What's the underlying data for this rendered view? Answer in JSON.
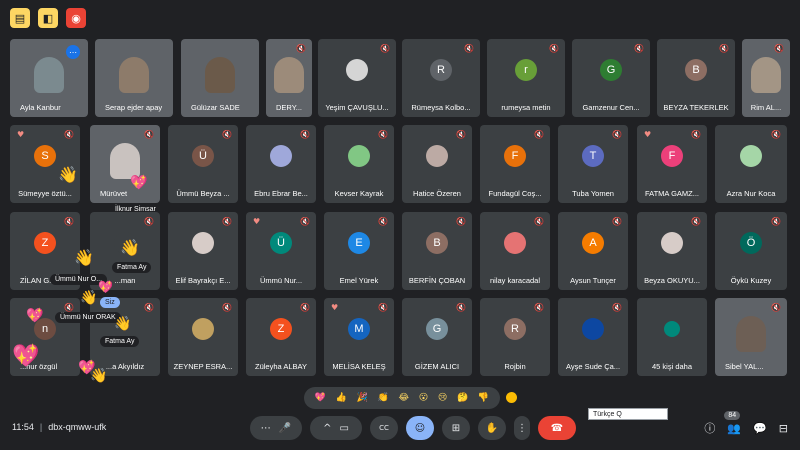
{
  "top_icons": [
    {
      "icon": "file-icon",
      "glyph": "▤",
      "style": "yellow"
    },
    {
      "icon": "present-icon",
      "glyph": "◧",
      "style": "yellow"
    },
    {
      "icon": "record-icon",
      "glyph": "◉",
      "style": "red"
    }
  ],
  "rows": [
    [
      {
        "name": "Ayla Kanbur",
        "video": true,
        "color": "#7b8a8f",
        "more": true,
        "left": true
      },
      {
        "name": "Serap ejder apay",
        "video": true,
        "color": "#8d7b6a",
        "left": true
      },
      {
        "name": "Gülüzar SADE",
        "video": true,
        "color": "#6b5a4a",
        "left": true
      },
      {
        "name": "DERY...",
        "video": true,
        "color": "#9c8b7a",
        "muted": true,
        "left": true
      },
      {
        "name": "Yeşim ÇAVUŞLU...",
        "initial": "",
        "color": "#d5d5d5",
        "muted": true,
        "image_avatar": true
      },
      {
        "name": "Rümeysa Kolbo...",
        "initial": "R",
        "color": "#5f6368",
        "muted": true
      },
      {
        "name": "rumeysa metin",
        "initial": "r",
        "color": "#689f38",
        "muted": true
      },
      {
        "name": "Gamzenur Cen...",
        "initial": "G",
        "color": "#2e7d32",
        "muted": true
      },
      {
        "name": "BEYZA TEKERLEK",
        "initial": "B",
        "color": "#8d6e63",
        "muted": true
      },
      {
        "name": "Rim AL...",
        "video": true,
        "color": "#a39585",
        "muted": true
      }
    ],
    [
      {
        "name": "Sümeyye öztü...",
        "initial": "S",
        "color": "#e8710a",
        "muted": true,
        "heart": true
      },
      {
        "name": "Mürüvet",
        "video": true,
        "color": "#c9c2bf",
        "muted": true,
        "left": true
      },
      {
        "name": "Ümmü Beyza ...",
        "initial": "Ü",
        "color": "#795548",
        "muted": true
      },
      {
        "name": "Ebru Ebrar Be...",
        "initial": "",
        "color": "#9fa8da",
        "muted": true,
        "image_avatar": true
      },
      {
        "name": "Kevser Kayrak",
        "initial": "",
        "color": "#81c784",
        "muted": true,
        "image_avatar": true
      },
      {
        "name": "Hatice Özeren",
        "initial": "",
        "color": "#bcaaa4",
        "muted": true,
        "image_avatar": true
      },
      {
        "name": "Fundagül Coş...",
        "initial": "F",
        "color": "#e8710a",
        "muted": true
      },
      {
        "name": "Tuba Yomen",
        "initial": "T",
        "color": "#5c6bc0",
        "muted": true
      },
      {
        "name": "FATMA GAMZ...",
        "initial": "F",
        "color": "#ec407a",
        "muted": true,
        "heart": true
      },
      {
        "name": "Azra Nur Koca",
        "initial": "",
        "color": "#a5d6a7",
        "muted": true,
        "image_avatar": true
      }
    ],
    [
      {
        "name": "ZİLAN G...",
        "initial": "Z",
        "color": "#f4511e",
        "muted": true,
        "left": true
      },
      {
        "name": "...man",
        "initial": "",
        "color": "#3c4043",
        "muted": true
      },
      {
        "name": "Elif Bayrakçı E...",
        "initial": "",
        "color": "#d7ccc8",
        "muted": true,
        "image_avatar": true
      },
      {
        "name": "Ümmü Nur...",
        "initial": "Ü",
        "color": "#00897b",
        "muted": true,
        "heart": true
      },
      {
        "name": "Emel Yürek",
        "initial": "E",
        "color": "#1e88e5",
        "muted": true
      },
      {
        "name": "BERFİN ÇOBAN",
        "initial": "B",
        "color": "#8d6e63",
        "muted": true
      },
      {
        "name": "nilay karacadal",
        "initial": "",
        "color": "#e57373",
        "muted": true,
        "image_avatar": true
      },
      {
        "name": "Aysun Tunçer",
        "initial": "A",
        "color": "#f57c00",
        "muted": true
      },
      {
        "name": "Beyza OKUYU...",
        "initial": "",
        "color": "#d7ccc8",
        "muted": true,
        "image_avatar": true
      },
      {
        "name": "Öykü Kuzey",
        "initial": "Ö",
        "color": "#00695c",
        "muted": true
      }
    ],
    [
      {
        "name": "...nur özgül",
        "initial": "n",
        "color": "#6d4c41",
        "muted": true,
        "left": true
      },
      {
        "name": "...a Akyıldız",
        "initial": "",
        "color": "#3c4043",
        "muted": true
      },
      {
        "name": "ZEYNEP ESRA...",
        "initial": "",
        "color": "#c0a060",
        "muted": true,
        "image_avatar": true
      },
      {
        "name": "Züleyha ALBAY",
        "initial": "Z",
        "color": "#f4511e",
        "muted": true
      },
      {
        "name": "MELİSA KELEŞ",
        "initial": "M",
        "color": "#1565c0",
        "muted": true,
        "heart": true
      },
      {
        "name": "GİZEM ALICI",
        "initial": "G",
        "color": "#78909c",
        "muted": true
      },
      {
        "name": "Rojbin",
        "initial": "R",
        "color": "#8d6e63",
        "muted": true
      },
      {
        "name": "Ayşe Sude Ça...",
        "initial": "",
        "color": "#0d47a1",
        "muted": true,
        "image_avatar": true
      },
      {
        "name": "45 kişi daha",
        "initial": "",
        "color": "#00897b",
        "more_people": true
      },
      {
        "name": "Sibel YAL...",
        "video": true,
        "color": "#6d5f55",
        "muted": true,
        "left": true
      }
    ]
  ],
  "floating": {
    "self_video_name": "İlknur Simsar",
    "labels": [
      {
        "text": "Fatma Ay",
        "blue": false
      },
      {
        "text": "Ümmü Nur O...",
        "blue": false
      },
      {
        "text": "Siz",
        "blue": true
      },
      {
        "text": "Ümmü Nur ORAK",
        "blue": false
      },
      {
        "text": "Fatma Ay",
        "blue": false
      }
    ]
  },
  "reactions": [
    "💖",
    "👍",
    "🎉",
    "👏",
    "😂",
    "😮",
    "😢",
    "🤔",
    "👎"
  ],
  "caption": {
    "text": "Türkçe Q"
  },
  "meeting": {
    "time": "11:54",
    "separator": "|",
    "code": "dbx-qmww-ufk"
  },
  "controls": {
    "more_options": "⋯",
    "mic": "🎤",
    "chevron_up": "^",
    "camera": "▭",
    "captions": "CC",
    "emoji": "☺",
    "present": "⊞",
    "raise_hand": "✋",
    "dots": "⋮",
    "leave": "☎"
  },
  "right_controls": {
    "info": "ⓘ",
    "people": "👥",
    "people_count": "84",
    "chat": "💬",
    "activities": "⊟"
  }
}
